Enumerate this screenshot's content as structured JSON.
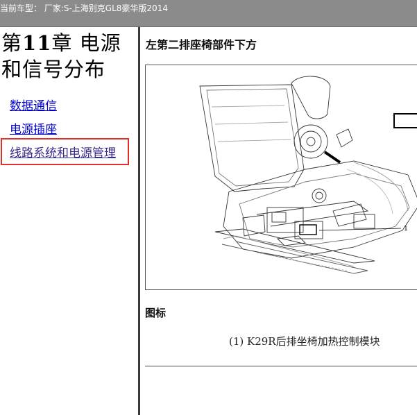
{
  "header": {
    "vehicle_text": "当前车型： 厂家:S-上海别克GL8豪华版2014"
  },
  "sidebar": {
    "chapter_title_prefix": "第",
    "chapter_number": "11",
    "chapter_title_suffix": "章 电源和信号分布",
    "links": [
      {
        "label": "数据通信"
      },
      {
        "label": "电源插座"
      },
      {
        "label": "线路系统和电源管理"
      }
    ]
  },
  "content": {
    "heading": "左第二排座椅部件下方",
    "figure": {
      "callout": "1"
    },
    "legend_heading": "图标",
    "legend_items": [
      {
        "text": "(1) K29R后排坐椅加热控制模块"
      }
    ]
  },
  "colors": {
    "header_bg": "#8b8b8b",
    "link": "#0000cc",
    "highlight_border": "#e0302a"
  }
}
